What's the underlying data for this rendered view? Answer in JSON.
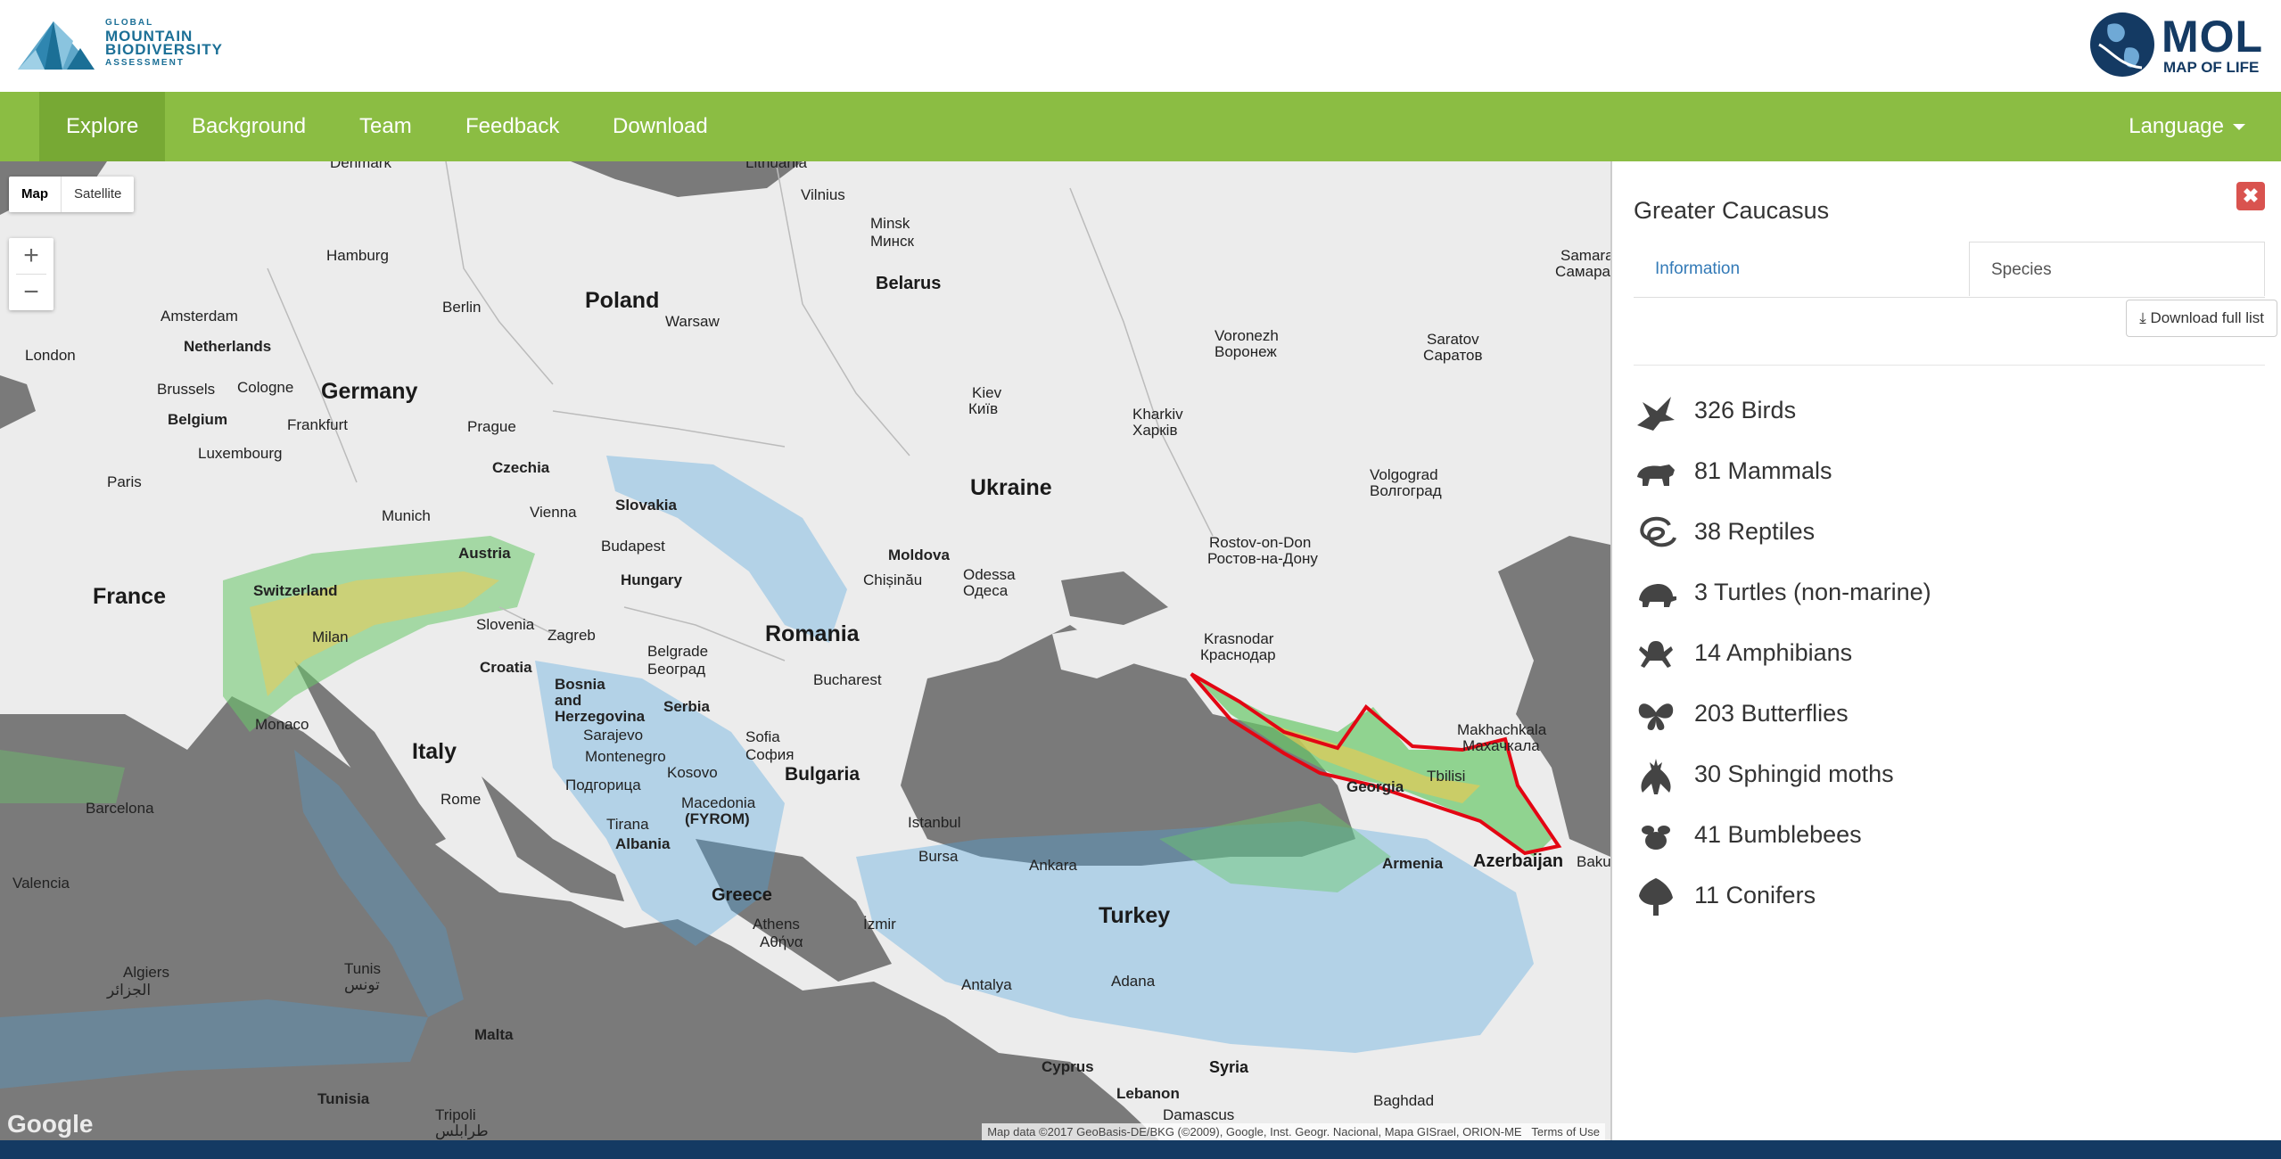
{
  "header": {
    "gmba_logo": {
      "line1": "GLOBAL",
      "line2": "MOUNTAIN",
      "line3": "BIODIVERSITY",
      "line4": "ASSESSMENT"
    },
    "mol_logo": {
      "title": "MOL",
      "subtitle": "MAP OF LIFE"
    }
  },
  "nav": {
    "items": [
      {
        "label": "Explore",
        "active": true
      },
      {
        "label": "Background",
        "active": false
      },
      {
        "label": "Team",
        "active": false
      },
      {
        "label": "Feedback",
        "active": false
      },
      {
        "label": "Download",
        "active": false
      }
    ],
    "language_label": "Language"
  },
  "map": {
    "type_controls": {
      "map": "Map",
      "satellite": "Satellite",
      "selected": "Map"
    },
    "zoom": {
      "in": "+",
      "out": "−"
    },
    "labels": {
      "denmark": "Denmark",
      "lithuania": "Lithuania",
      "vilnius": "Vilnius",
      "minsk": "Minsk",
      "minsk_cyr": "Минск",
      "belarus": "Belarus",
      "hamburg": "Hamburg",
      "amsterdam": "Amsterdam",
      "netherlands": "Netherlands",
      "berlin": "Berlin",
      "poland": "Poland",
      "warsaw": "Warsaw",
      "london": "London",
      "brussels": "Brussels",
      "cologne": "Cologne",
      "germany": "Germany",
      "belgium": "Belgium",
      "frankfurt": "Frankfurt",
      "luxembourg": "Luxembourg",
      "prague": "Prague",
      "czechia": "Czechia",
      "paris": "Paris",
      "munich": "Munich",
      "vienna": "Vienna",
      "slovakia": "Slovakia",
      "budapest": "Budapest",
      "hungary": "Hungary",
      "france": "France",
      "switzerland": "Switzerland",
      "austria": "Austria",
      "slovenia": "Slovenia",
      "zagreb": "Zagreb",
      "milan": "Milan",
      "croatia": "Croatia",
      "belgrade": "Belgrade",
      "belgrade_cyr": "Београд",
      "romania": "Romania",
      "bucharest": "Bucharest",
      "bosnia": "Bosnia and Herzegovina",
      "serbia": "Serbia",
      "monaco": "Monaco",
      "italy": "Italy",
      "sarajevo": "Sarajevo",
      "montenegro": "Montenegro",
      "podgorica": "Podgorica",
      "podgorica_cyr": "Подгорица",
      "kosovo": "Kosovo",
      "sofia": "Sofia",
      "sofia_cyr": "София",
      "bulgaria": "Bulgaria",
      "macedonia": "Macedonia",
      "fyrom": "(FYROM)",
      "tirana": "Tirana",
      "albania": "Albania",
      "rome": "Rome",
      "barcelona": "Barcelona",
      "valencia": "Valencia",
      "greece": "Greece",
      "athens": "Athens",
      "athens_gr": "Αθήνα",
      "istanbul": "Istanbul",
      "bursa": "Bursa",
      "izmir": "İzmir",
      "ankara": "Ankara",
      "turkey": "Turkey",
      "antalya": "Antalya",
      "adana": "Adana",
      "algiers": "Algiers",
      "algiers_ar": "الجزائر",
      "tunis": "Tunis",
      "tunis_ar": "تونس",
      "malta": "Malta",
      "tunisia": "Tunisia",
      "tripoli": "Tripoli",
      "tripoli_ar": "طرابلس",
      "cyprus": "Cyprus",
      "lebanon": "Lebanon",
      "damascus": "Damascus",
      "syria": "Syria",
      "baghdad": "Baghdad",
      "ukraine": "Ukraine",
      "kiev": "Kiev",
      "kiev_cyr": "Київ",
      "kharkiv": "Kharkiv",
      "kharkiv_cyr": "Харків",
      "voronezh": "Voronezh",
      "voronezh_cyr": "Воронеж",
      "saratov": "Saratov",
      "saratov_cyr": "Саратов",
      "samara": "Samara",
      "samara_cyr": "Самара",
      "moldova": "Moldova",
      "chisinau": "Chișinău",
      "odessa": "Odessa",
      "odessa_cyr": "Одеса",
      "volgograd": "Volgograd",
      "volgograd_cyr": "Волгоград",
      "rostov": "Rostov-on-Don",
      "rostov_cyr": "Ростов-на-Дону",
      "krasnodar": "Krasnodar",
      "krasnodar_cyr": "Краснодар",
      "makhachkala": "Makhachkala",
      "makhachkala_cyr": "Махачкала",
      "georgia": "Georgia",
      "tbilisi": "Tbilisi",
      "armenia": "Armenia",
      "azerbaijan": "Azerbaijan",
      "baku": "Baku"
    },
    "attribution": "Map data ©2017 GeoBasis-DE/BKG (©2009), Google, Inst. Geogr. Nacional, Mapa GISrael, ORION-ME",
    "terms": "Terms of Use",
    "google": "Google"
  },
  "panel": {
    "region_name": "Greater Caucasus",
    "tabs": {
      "information": "Information",
      "species": "Species"
    },
    "download_label": "Download full list",
    "close_label": "✖",
    "taxa": [
      {
        "count": "326",
        "name": "Birds",
        "icon": "bird-icon"
      },
      {
        "count": "81",
        "name": "Mammals",
        "icon": "mammal-icon"
      },
      {
        "count": "38",
        "name": "Reptiles",
        "icon": "reptile-icon"
      },
      {
        "count": "3",
        "name": "Turtles (non-marine)",
        "icon": "turtle-icon"
      },
      {
        "count": "14",
        "name": "Amphibians",
        "icon": "amphibian-icon"
      },
      {
        "count": "203",
        "name": "Butterflies",
        "icon": "butterfly-icon"
      },
      {
        "count": "30",
        "name": "Sphingid moths",
        "icon": "moth-icon"
      },
      {
        "count": "41",
        "name": "Bumblebees",
        "icon": "bumblebee-icon"
      },
      {
        "count": "11",
        "name": "Conifers",
        "icon": "conifer-icon"
      }
    ],
    "taxa_text": [
      "326 Birds",
      "81 Mammals",
      "38 Reptiles",
      "3 Turtles (non-marine)",
      "14 Amphibians",
      "203 Butterflies",
      "30 Sphingid moths",
      "41 Bumblebees",
      "11 Conifers"
    ]
  },
  "colors": {
    "nav_green": "#8bbd43",
    "nav_active": "#77a934",
    "mol_blue": "#143a63",
    "link_blue": "#337ab7",
    "close_red": "#d9534f",
    "region_outline": "#e30613"
  }
}
